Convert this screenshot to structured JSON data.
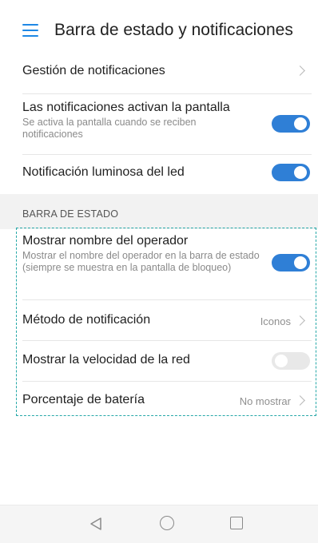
{
  "header": {
    "title": "Barra de estado y notificaciones",
    "menu_icon": "hamburger-menu-icon"
  },
  "settings": [
    {
      "title": "Gestión de notificaciones",
      "control": "chevron"
    },
    {
      "title": "Las notificaciones activan la pantalla",
      "subtitle": "Se activa la pantalla cuando se reciben notificaciones",
      "control": "toggle",
      "enabled": true
    },
    {
      "title": "Notificación luminosa del led",
      "control": "toggle",
      "enabled": true
    }
  ],
  "status_section": {
    "label": "BARRA DE ESTADO",
    "items": [
      {
        "title": "Mostrar nombre del operador",
        "subtitle": "Mostrar el nombre del operador en la barra de estado (siempre se muestra en la pantalla de bloqueo)",
        "control": "toggle",
        "enabled": true
      },
      {
        "title": "Método de notificación",
        "value": "Iconos",
        "control": "chevron"
      },
      {
        "title": "Mostrar la velocidad de la red",
        "control": "toggle",
        "enabled": false
      },
      {
        "title": "Porcentaje de batería",
        "value": "No mostrar",
        "control": "chevron"
      }
    ]
  },
  "colors": {
    "accent": "#2f7fd6",
    "highlight_border": "#26a8a8",
    "toggle_off": "#e8e8e8"
  },
  "navbar": {
    "icons": [
      "back-triangle-icon",
      "home-circle-icon",
      "recent-apps-square-icon"
    ]
  }
}
